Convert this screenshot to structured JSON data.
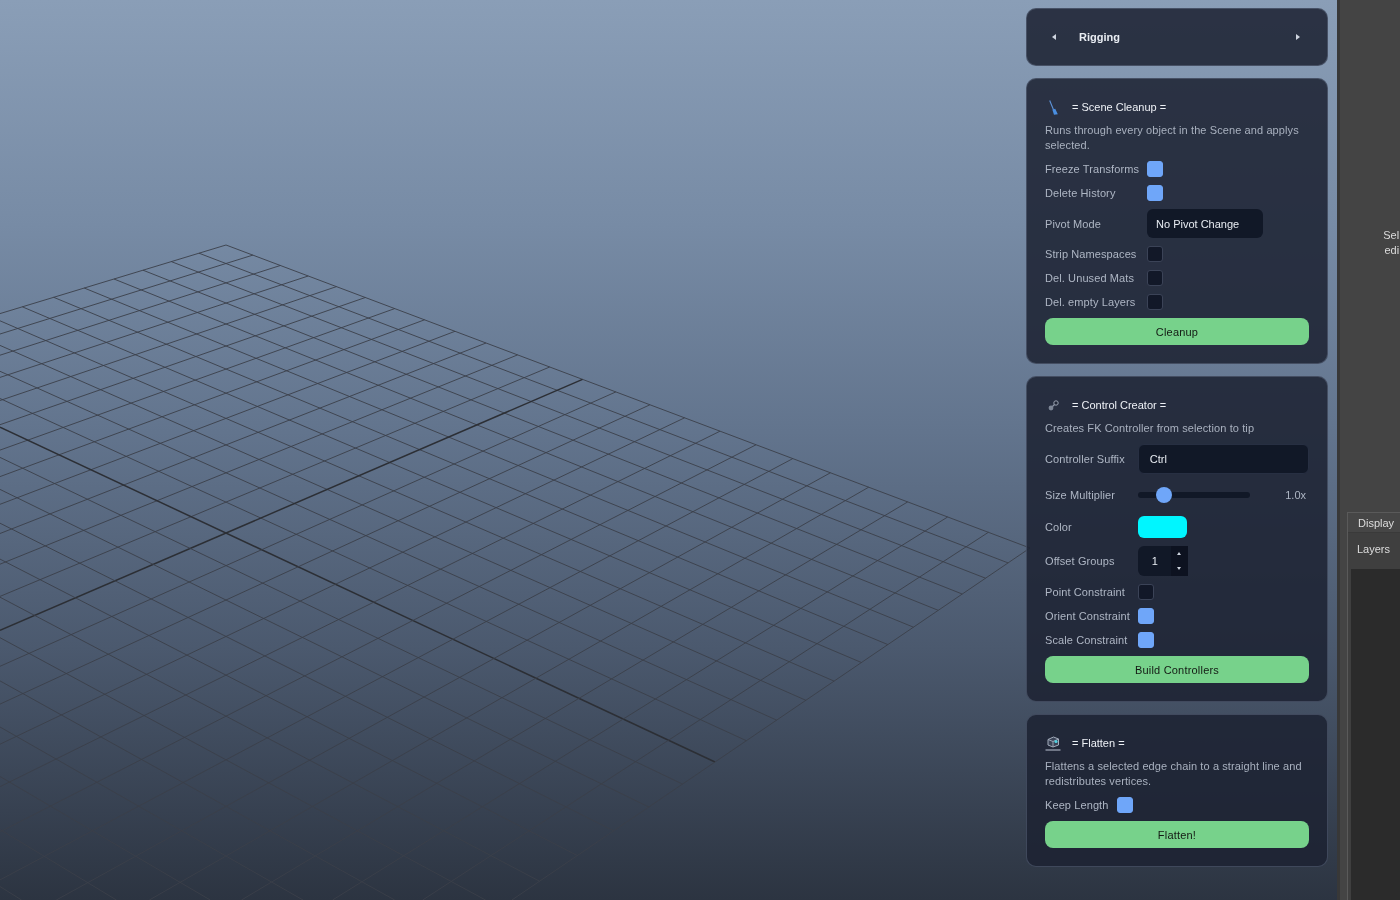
{
  "category_switcher": {
    "label": "Rigging"
  },
  "sections": [
    {
      "kind": "scene_cleanup",
      "title": "= Scene Cleanup =",
      "description": "Runs through every object in the Scene and applys selected.",
      "fields": [
        {
          "kind": "checkbox",
          "label": "Freeze Transforms",
          "checked": true
        },
        {
          "kind": "checkbox",
          "label": "Delete History",
          "checked": true
        },
        {
          "kind": "dropdown",
          "label": "Pivot Mode",
          "value": "No Pivot Change"
        },
        {
          "kind": "checkbox",
          "label": "Strip Namespaces",
          "checked": false
        },
        {
          "kind": "checkbox",
          "label": "Del. Unused Mats",
          "checked": false
        },
        {
          "kind": "checkbox",
          "label": "Del. empty Layers",
          "checked": false
        }
      ],
      "button": "Cleanup"
    },
    {
      "kind": "control_creator",
      "title": "= Control Creator =",
      "description": "Creates FK Controller from selection to tip",
      "fields": [
        {
          "kind": "text",
          "label": "Controller Suffix",
          "value": "Ctrl"
        },
        {
          "kind": "slider",
          "label": "Size Multiplier",
          "level": 0.23,
          "reading": "1.0x"
        },
        {
          "kind": "color",
          "label": "Color",
          "color": "#00f6ff"
        },
        {
          "kind": "spinbox",
          "label": "Offset Groups",
          "value": "1"
        },
        {
          "kind": "checkbox",
          "label": "Point Constraint",
          "checked": false
        },
        {
          "kind": "checkbox",
          "label": "Orient Constraint",
          "checked": true
        },
        {
          "kind": "checkbox",
          "label": "Scale Constraint",
          "checked": true
        }
      ],
      "button": "Build Controllers"
    },
    {
      "kind": "flatten",
      "title": "= Flatten =",
      "description": "Flattens a selected edge chain to a straight line and redistributes vertices.",
      "fields": [
        {
          "kind": "checkbox",
          "label": "Keep Length",
          "checked": true
        }
      ],
      "button": "Flatten!"
    }
  ],
  "side_panel": {
    "message_lines": [
      "Sel",
      "edi"
    ],
    "tab": "Display",
    "menu": [
      "Layers"
    ]
  }
}
